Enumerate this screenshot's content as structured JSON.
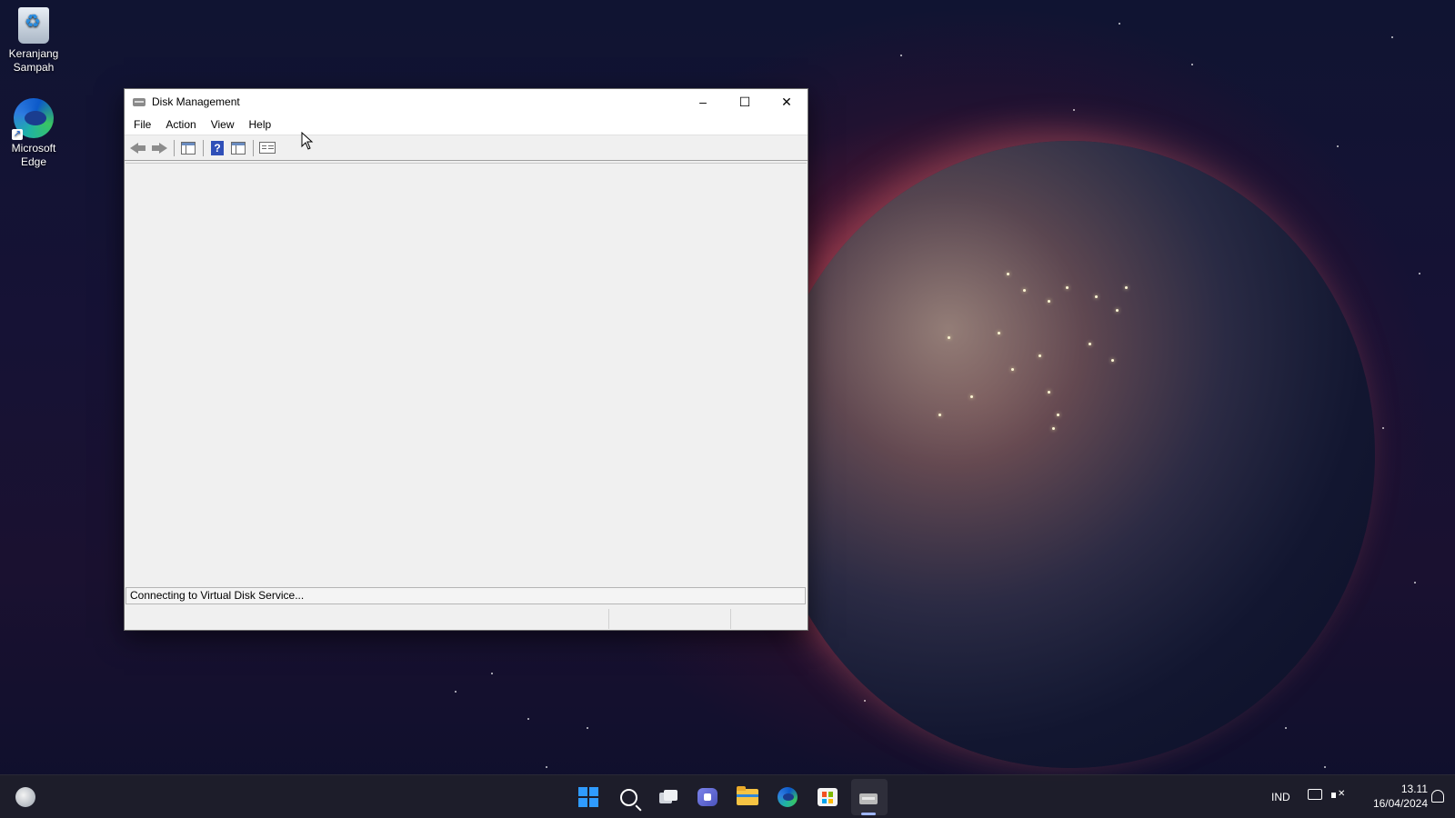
{
  "desktop": {
    "icons": [
      {
        "label_line1": "Keranjang",
        "label_line2": "Sampah",
        "icon": "recycle-bin-icon"
      },
      {
        "label_line1": "Microsoft",
        "label_line2": "Edge",
        "icon": "edge-icon"
      }
    ]
  },
  "window": {
    "title": "Disk Management",
    "icon": "disk-management-icon",
    "controls": {
      "minimize": "–",
      "maximize": "☐",
      "close": "✕"
    },
    "menu": [
      "File",
      "Action",
      "View",
      "Help"
    ],
    "toolbar_icons": [
      "back-arrow-icon",
      "forward-arrow-icon",
      "show-hide-console-tree-icon",
      "help-icon",
      "show-hide-action-pane-icon",
      "properties-icon"
    ],
    "status_text": "Connecting to Virtual Disk Service..."
  },
  "taskbar": {
    "pinned": [
      "widgets-weather-icon",
      "start-icon",
      "search-icon",
      "task-view-icon",
      "chat-icon",
      "file-explorer-icon",
      "edge-icon",
      "store-icon",
      "disk-management-icon"
    ],
    "active_app": "disk-management-icon",
    "language": "IND",
    "time": "13.11",
    "date": "16/04/2024"
  }
}
